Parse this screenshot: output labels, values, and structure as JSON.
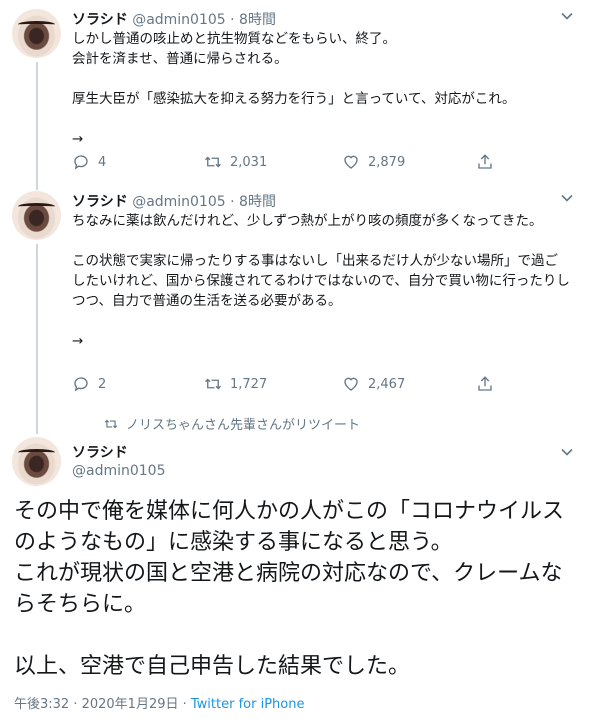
{
  "tweets": [
    {
      "name": "ソラシド",
      "handle": "@admin0105",
      "dot": "·",
      "time": "8時間",
      "text": "しかし普通の咳止めと抗生物質などをもらい、終了。\n会計を済ませ、普通に帰らされる。\n\n厚生大臣が「感染拡大を抑える努力を行う」と言っていて、対応がこれ。\n\n→",
      "replies": "4",
      "retweets": "2,031",
      "likes": "2,879"
    },
    {
      "name": "ソラシド",
      "handle": "@admin0105",
      "dot": "·",
      "time": "8時間",
      "text": "ちなみに薬は飲んだけれど、少しずつ熱が上がり咳の頻度が多くなってきた。\n\nこの状態で実家に帰ったりする事はないし「出来るだけ人が少ない場所」で過ごしたいけれど、国から保護されてるわけではないので、自分で買い物に行ったりしつつ、自力で普通の生活を送る必要がある。\n\n→",
      "replies": "2",
      "retweets": "1,727",
      "likes": "2,467"
    }
  ],
  "retweet_notice": "ノリスちゃんさん先輩さんがリツイート",
  "main_tweet": {
    "name": "ソラシド",
    "handle": "@admin0105",
    "text": "その中で俺を媒体に何人かの人がこの「コロナウイルスのようなもの」に感染する事になると思う。\nこれが現状の国と空港と病院の対応なので、クレームならそちらに。\n\n以上、空港で自己申告した結果でした。",
    "timestamp": "午後3:32 · 2020年1月29日 · ",
    "source": "Twitter for iPhone"
  },
  "icons": {
    "reply": "reply-icon",
    "retweet": "retweet-icon",
    "like": "heart-icon",
    "share": "share-icon",
    "caret": "chevron-down-icon"
  },
  "colors": {
    "text": "#14171a",
    "secondary": "#657786",
    "link": "#1b95e0",
    "thread_line": "#ccd6dd"
  }
}
